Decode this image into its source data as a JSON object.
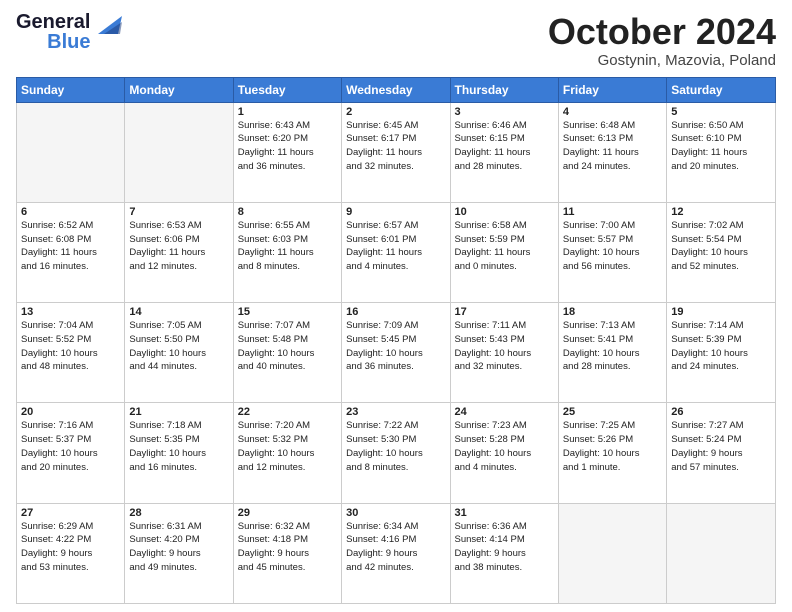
{
  "logo": {
    "general": "General",
    "blue": "Blue",
    "wing_color": "#3a7bd5"
  },
  "header": {
    "month": "October 2024",
    "location": "Gostynin, Mazovia, Poland"
  },
  "days_of_week": [
    "Sunday",
    "Monday",
    "Tuesday",
    "Wednesday",
    "Thursday",
    "Friday",
    "Saturday"
  ],
  "weeks": [
    [
      {
        "day": "",
        "info": ""
      },
      {
        "day": "",
        "info": ""
      },
      {
        "day": "1",
        "info": "Sunrise: 6:43 AM\nSunset: 6:20 PM\nDaylight: 11 hours\nand 36 minutes."
      },
      {
        "day": "2",
        "info": "Sunrise: 6:45 AM\nSunset: 6:17 PM\nDaylight: 11 hours\nand 32 minutes."
      },
      {
        "day": "3",
        "info": "Sunrise: 6:46 AM\nSunset: 6:15 PM\nDaylight: 11 hours\nand 28 minutes."
      },
      {
        "day": "4",
        "info": "Sunrise: 6:48 AM\nSunset: 6:13 PM\nDaylight: 11 hours\nand 24 minutes."
      },
      {
        "day": "5",
        "info": "Sunrise: 6:50 AM\nSunset: 6:10 PM\nDaylight: 11 hours\nand 20 minutes."
      }
    ],
    [
      {
        "day": "6",
        "info": "Sunrise: 6:52 AM\nSunset: 6:08 PM\nDaylight: 11 hours\nand 16 minutes."
      },
      {
        "day": "7",
        "info": "Sunrise: 6:53 AM\nSunset: 6:06 PM\nDaylight: 11 hours\nand 12 minutes."
      },
      {
        "day": "8",
        "info": "Sunrise: 6:55 AM\nSunset: 6:03 PM\nDaylight: 11 hours\nand 8 minutes."
      },
      {
        "day": "9",
        "info": "Sunrise: 6:57 AM\nSunset: 6:01 PM\nDaylight: 11 hours\nand 4 minutes."
      },
      {
        "day": "10",
        "info": "Sunrise: 6:58 AM\nSunset: 5:59 PM\nDaylight: 11 hours\nand 0 minutes."
      },
      {
        "day": "11",
        "info": "Sunrise: 7:00 AM\nSunset: 5:57 PM\nDaylight: 10 hours\nand 56 minutes."
      },
      {
        "day": "12",
        "info": "Sunrise: 7:02 AM\nSunset: 5:54 PM\nDaylight: 10 hours\nand 52 minutes."
      }
    ],
    [
      {
        "day": "13",
        "info": "Sunrise: 7:04 AM\nSunset: 5:52 PM\nDaylight: 10 hours\nand 48 minutes."
      },
      {
        "day": "14",
        "info": "Sunrise: 7:05 AM\nSunset: 5:50 PM\nDaylight: 10 hours\nand 44 minutes."
      },
      {
        "day": "15",
        "info": "Sunrise: 7:07 AM\nSunset: 5:48 PM\nDaylight: 10 hours\nand 40 minutes."
      },
      {
        "day": "16",
        "info": "Sunrise: 7:09 AM\nSunset: 5:45 PM\nDaylight: 10 hours\nand 36 minutes."
      },
      {
        "day": "17",
        "info": "Sunrise: 7:11 AM\nSunset: 5:43 PM\nDaylight: 10 hours\nand 32 minutes."
      },
      {
        "day": "18",
        "info": "Sunrise: 7:13 AM\nSunset: 5:41 PM\nDaylight: 10 hours\nand 28 minutes."
      },
      {
        "day": "19",
        "info": "Sunrise: 7:14 AM\nSunset: 5:39 PM\nDaylight: 10 hours\nand 24 minutes."
      }
    ],
    [
      {
        "day": "20",
        "info": "Sunrise: 7:16 AM\nSunset: 5:37 PM\nDaylight: 10 hours\nand 20 minutes."
      },
      {
        "day": "21",
        "info": "Sunrise: 7:18 AM\nSunset: 5:35 PM\nDaylight: 10 hours\nand 16 minutes."
      },
      {
        "day": "22",
        "info": "Sunrise: 7:20 AM\nSunset: 5:32 PM\nDaylight: 10 hours\nand 12 minutes."
      },
      {
        "day": "23",
        "info": "Sunrise: 7:22 AM\nSunset: 5:30 PM\nDaylight: 10 hours\nand 8 minutes."
      },
      {
        "day": "24",
        "info": "Sunrise: 7:23 AM\nSunset: 5:28 PM\nDaylight: 10 hours\nand 4 minutes."
      },
      {
        "day": "25",
        "info": "Sunrise: 7:25 AM\nSunset: 5:26 PM\nDaylight: 10 hours\nand 1 minute."
      },
      {
        "day": "26",
        "info": "Sunrise: 7:27 AM\nSunset: 5:24 PM\nDaylight: 9 hours\nand 57 minutes."
      }
    ],
    [
      {
        "day": "27",
        "info": "Sunrise: 6:29 AM\nSunset: 4:22 PM\nDaylight: 9 hours\nand 53 minutes."
      },
      {
        "day": "28",
        "info": "Sunrise: 6:31 AM\nSunset: 4:20 PM\nDaylight: 9 hours\nand 49 minutes."
      },
      {
        "day": "29",
        "info": "Sunrise: 6:32 AM\nSunset: 4:18 PM\nDaylight: 9 hours\nand 45 minutes."
      },
      {
        "day": "30",
        "info": "Sunrise: 6:34 AM\nSunset: 4:16 PM\nDaylight: 9 hours\nand 42 minutes."
      },
      {
        "day": "31",
        "info": "Sunrise: 6:36 AM\nSunset: 4:14 PM\nDaylight: 9 hours\nand 38 minutes."
      },
      {
        "day": "",
        "info": ""
      },
      {
        "day": "",
        "info": ""
      }
    ]
  ]
}
